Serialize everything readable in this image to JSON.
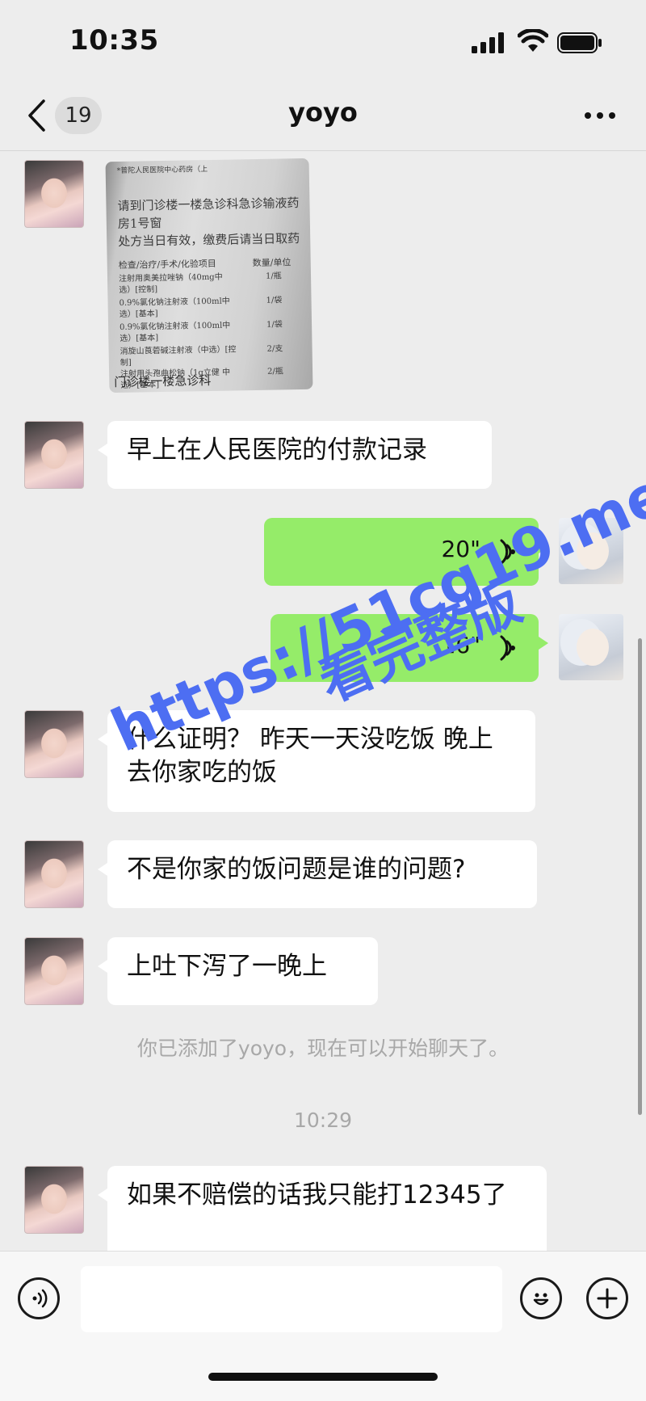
{
  "status_bar": {
    "time": "10:35"
  },
  "nav": {
    "unread_count": "19",
    "title": "yoyo"
  },
  "messages": {
    "m2": "早上在人民医院的付款记录",
    "m3_duration": "20\"",
    "m4_duration": "16\"",
    "m5": "什么证明？ 昨天一天没吃饭 晚上去你家吃的饭",
    "m6": "不是你家的饭问题是谁的问题?",
    "m7": "上吐下泻了一晚上",
    "system": "你已添加了yoyo，现在可以开始聊天了。",
    "time_divider": "10:29",
    "m8": "如果不赔偿的话我只能打12345了"
  },
  "prescription_photo": {
    "lines": [
      "*普陀人民医院中心药房（上",
      "请到门诊楼一楼急诊科急诊输液药",
      "房1号窗",
      "处方当日有效，缴费后请当日取药",
      "检查/治疗/手术/化验项目",
      "数量/单位",
      "注射用奥美拉唑钠（40mg中",
      "1/瓶",
      "选）[控制]",
      "0.9%氯化钠注射液（100ml中",
      "1/袋",
      "选）[基本]",
      "0.9%氯化钠注射液（100ml中",
      "1/袋",
      "选）[基本]",
      "消旋山莨菪碱注射液（中选）[控",
      "2/支",
      "制]",
      "注射用头孢曲松钠（1g立健 中",
      "2/瓶",
      "选）[基本]",
      "门诊楼一楼急诊科"
    ]
  },
  "watermark": {
    "line1": "https://51cg19.me",
    "line2": "看完整版"
  },
  "colors": {
    "background": "#ededed",
    "voice_bubble": "#95ec69",
    "watermark": "#4d6ef2"
  }
}
